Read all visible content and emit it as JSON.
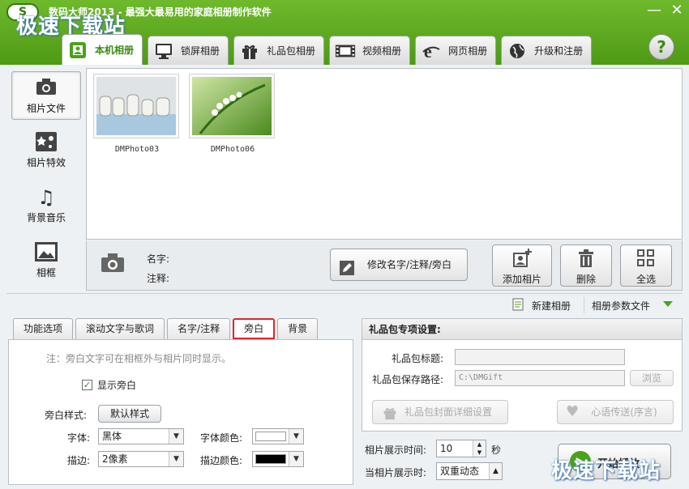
{
  "app": {
    "logo_text": "S",
    "title": "数码大师2013 - 最强大最易用的家庭相册制作软件",
    "watermark": "极速下载站"
  },
  "tabs": [
    {
      "label": "本机相册",
      "icon": "photo-album-icon"
    },
    {
      "label": "锁屏相册",
      "icon": "monitor-icon"
    },
    {
      "label": "礼品包相册",
      "icon": "gift-icon"
    },
    {
      "label": "视频相册",
      "icon": "film-icon"
    },
    {
      "label": "网页相册",
      "icon": "browser-icon"
    },
    {
      "label": "升级和注册",
      "icon": "globe-icon"
    }
  ],
  "sidebar": [
    {
      "label": "相片文件",
      "icon": "camera-icon",
      "active": true
    },
    {
      "label": "相片特效",
      "icon": "effects-icon",
      "active": false
    },
    {
      "label": "背景音乐",
      "icon": "music-note-icon",
      "active": false
    },
    {
      "label": "相框",
      "icon": "frame-icon",
      "active": false
    }
  ],
  "photos": [
    {
      "name": "DMPhoto03"
    },
    {
      "name": "DMPhoto06"
    }
  ],
  "info": {
    "name_label": "名字:",
    "note_label": "注释:",
    "edit_button": "修改名字/注释/旁白",
    "add_button": "添加相片",
    "delete_button": "删除",
    "select_all_button": "全选"
  },
  "toolbar": {
    "new_album": "新建相册",
    "album_params": "相册参数文件"
  },
  "lower_tabs": [
    "功能选项",
    "滚动文字与歌词",
    "名字/注释",
    "旁白",
    "背景"
  ],
  "narration": {
    "note": "注：旁白文字可在相框外与相片同时显示。",
    "show_label": "显示旁白",
    "show_checked": true,
    "style_label": "旁白样式:",
    "style_button": "默认样式",
    "font_label": "字体:",
    "font_value": "黑体",
    "font_color_label": "字体颜色:",
    "font_color": "#ffffff",
    "stroke_label": "描边:",
    "stroke_value": "2像素",
    "stroke_color_label": "描边颜色:",
    "stroke_color": "#000000"
  },
  "gift": {
    "header": "礼品包专项设置:",
    "title_label": "礼品包标题:",
    "title_value": "",
    "path_label": "礼品包保存路径:",
    "path_value": "C:\\DMGift",
    "browse_button": "浏览",
    "cover_button": "礼品包封面详细设置",
    "message_button": "心语传送(序言)"
  },
  "playback": {
    "duration_label": "相片展示时间:",
    "duration_value": "10",
    "duration_unit": "秒",
    "effect_label": "当相片展示时:",
    "effect_value": "双重动态",
    "start_button": "开始播放"
  },
  "colors": {
    "title_green": "#5aa71f",
    "active_tab_text": "#3a8a10",
    "highlight_red": "#d9272e"
  }
}
